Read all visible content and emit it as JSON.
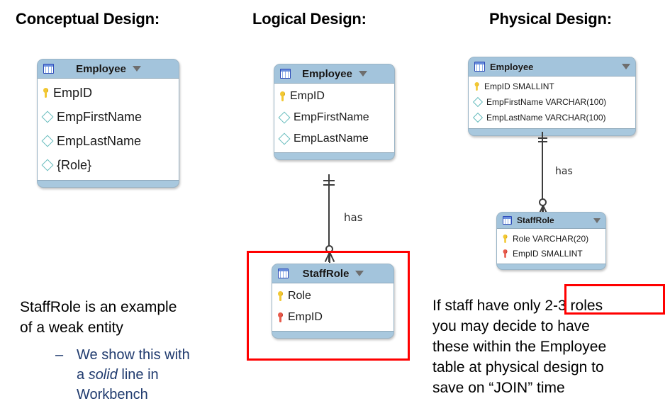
{
  "slide": {
    "background": "#ffffff",
    "accent_red": "#ff0000",
    "card_header_color": "#a3c4dc",
    "sub_bullet_color": "#1f3a6e",
    "pk_key_color": "#f2c832",
    "fk_key_color": "#e8594a",
    "attribute_diamond_color": "#66bcbd"
  },
  "headings": {
    "conceptual": "Conceptual Design:",
    "logical": "Logical Design:",
    "physical": "Physical Design:"
  },
  "conceptual": {
    "employee": {
      "icon": "table-icon",
      "title": "Employee",
      "caret": "chevron-down-icon",
      "rows": [
        {
          "glyph": "primary-key-icon",
          "label": "EmpID"
        },
        {
          "glyph": "attribute-diamond-icon",
          "label": "EmpFirstName"
        },
        {
          "glyph": "attribute-diamond-icon",
          "label": "EmpLastName"
        },
        {
          "glyph": "attribute-diamond-icon",
          "label": "{Role}"
        }
      ]
    }
  },
  "logical": {
    "employee": {
      "icon": "table-icon",
      "title": "Employee",
      "caret": "chevron-down-icon",
      "rows": [
        {
          "glyph": "primary-key-icon",
          "label": "EmpID"
        },
        {
          "glyph": "attribute-diamond-icon",
          "label": "EmpFirstName"
        },
        {
          "glyph": "attribute-diamond-icon",
          "label": "EmpLastName"
        }
      ]
    },
    "relationship_label": "has",
    "staffrole": {
      "icon": "table-icon",
      "title": "StaffRole",
      "caret": "chevron-down-icon",
      "rows": [
        {
          "glyph": "primary-key-icon",
          "label": "Role"
        },
        {
          "glyph": "foreign-key-icon",
          "label": "EmpID"
        }
      ]
    }
  },
  "physical": {
    "employee": {
      "icon": "table-icon",
      "title": "Employee",
      "caret": "chevron-down-icon",
      "rows": [
        {
          "glyph": "primary-key-icon",
          "label": "EmpID SMALLINT"
        },
        {
          "glyph": "attribute-diamond-icon",
          "label": "EmpFirstName VARCHAR(100)"
        },
        {
          "glyph": "attribute-diamond-icon",
          "label": "EmpLastName VARCHAR(100)"
        }
      ]
    },
    "relationship_label": "has",
    "staffrole": {
      "icon": "table-icon",
      "title": "StaffRole",
      "caret": "chevron-down-icon",
      "rows": [
        {
          "glyph": "primary-key-icon",
          "label": "Role VARCHAR(20)"
        },
        {
          "glyph": "foreign-key-icon",
          "label": "EmpID SMALLINT"
        }
      ]
    }
  },
  "notes": {
    "left_main_line1": "StaffRole is an example",
    "left_main_line2": "of a weak entity",
    "left_sub_dash": "–",
    "left_sub_part1": "We show this with",
    "left_sub_part2_a": "a ",
    "left_sub_part2_italic": "solid",
    "left_sub_part2_b": " line in",
    "left_sub_part3": "Workbench",
    "right_line1": "If staff have only 2-3 roles",
    "right_line2": "you may decide to have",
    "right_line3": "these within the Employee",
    "right_line4": "table at physical design to",
    "right_line5": "save on “JOIN” time"
  },
  "annotations": {
    "highlight_staffrole_table": "red-highlight-box",
    "highlight_2_3_roles": "red-highlight-box"
  }
}
